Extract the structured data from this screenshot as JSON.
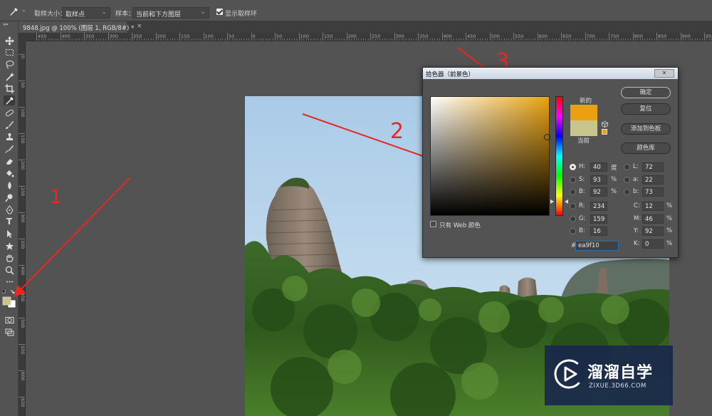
{
  "options": {
    "sample_size_label": "取样大小：",
    "sample_size_value": "取样点",
    "sample_label": "样本：",
    "sample_value": "当前和下方图层",
    "show_ring_label": "显示取样环",
    "show_ring_checked": true
  },
  "document": {
    "tab_title": "9848.jpg @ 100% (图层 1, RGB/8#) *",
    "close": "×"
  },
  "ruler_h_ticks": [
    "450",
    "400",
    "350",
    "300",
    "250",
    "200",
    "150",
    "100",
    "50",
    "0",
    "50",
    "100",
    "150",
    "200",
    "250",
    "300",
    "350",
    "400",
    "450",
    "500",
    "550",
    "600",
    "650",
    "700",
    "750",
    "800",
    "850",
    "900",
    "950"
  ],
  "ruler_v_ticks": [
    "0",
    "50",
    "100",
    "150",
    "200",
    "250",
    "300",
    "350",
    "400",
    "450",
    "500",
    "550",
    "600",
    "650"
  ],
  "tools": [
    "move-icon",
    "marquee-icon",
    "lasso-icon",
    "magic-wand-icon",
    "crop-icon",
    "eyedropper-icon",
    "healing-icon",
    "brush-icon",
    "stamp-icon",
    "history-brush-icon",
    "eraser-icon",
    "bucket-icon",
    "blur-icon",
    "dodge-icon",
    "pen-icon",
    "type-icon",
    "path-select-icon",
    "shape-icon",
    "hand-icon",
    "zoom-icon",
    "more-icon"
  ],
  "toolbar": {
    "type_glyph": "T"
  },
  "color_picker": {
    "title": "拾色器（前景色）",
    "close": "✕",
    "new_label": "新的",
    "current_label": "当前",
    "new_color": "#eaa010",
    "current_color": "#c8c68c",
    "buttons": {
      "ok": "确定",
      "reset": "复位",
      "add_swatch": "添加到色板",
      "color_library": "颜色库"
    },
    "web_only_label": "只有 Web 颜色",
    "fields": {
      "H": {
        "label": "H:",
        "value": "40",
        "unit": "度"
      },
      "S": {
        "label": "S:",
        "value": "93",
        "unit": "%"
      },
      "B": {
        "label": "B:",
        "value": "92",
        "unit": "%"
      },
      "R": {
        "label": "R:",
        "value": "234"
      },
      "G": {
        "label": "G:",
        "value": "159"
      },
      "Bl": {
        "label": "B:",
        "value": "16"
      },
      "L": {
        "label": "L:",
        "value": "72"
      },
      "a": {
        "label": "a:",
        "value": "22"
      },
      "b": {
        "label": "b:",
        "value": "73"
      },
      "C": {
        "label": "C:",
        "value": "12",
        "unit": "%"
      },
      "M": {
        "label": "M:",
        "value": "46",
        "unit": "%"
      },
      "Y": {
        "label": "Y:",
        "value": "92",
        "unit": "%"
      },
      "K": {
        "label": "K:",
        "value": "0",
        "unit": "%"
      }
    },
    "hash": "#",
    "hex": "ea9f10"
  },
  "annotations": {
    "n1": "1",
    "n2": "2",
    "n3": "3"
  },
  "watermark": {
    "text": "溜溜自学",
    "url": "ZIXUE.3D66.COM"
  },
  "colors": {
    "foreground": "#c8c68c",
    "background": "#ffffff",
    "arrow": "#e8281e"
  }
}
